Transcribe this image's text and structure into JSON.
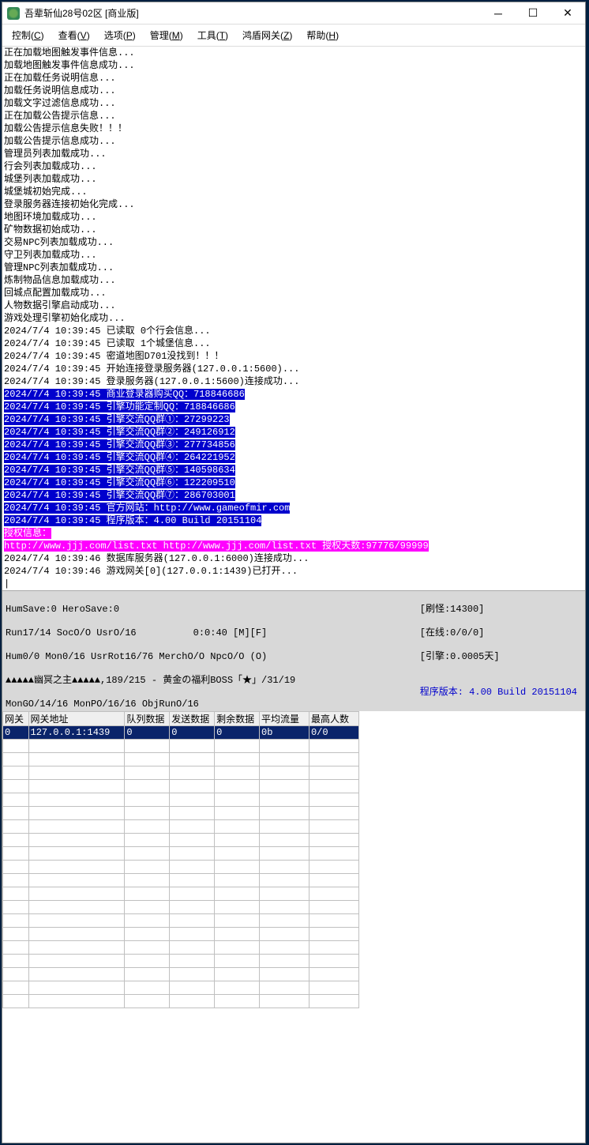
{
  "window": {
    "title": "吾辈斩仙28号02区 [商业版]"
  },
  "menu": {
    "items": [
      {
        "label": "控制",
        "key": "C"
      },
      {
        "label": "查看",
        "key": "V"
      },
      {
        "label": "选项",
        "key": "P"
      },
      {
        "label": "管理",
        "key": "M"
      },
      {
        "label": "工具",
        "key": "T"
      },
      {
        "label": "鸿盾网关",
        "key": "Z"
      },
      {
        "label": "帮助",
        "key": "H"
      }
    ]
  },
  "log": [
    {
      "t": "正在加载地图触发事件信息..."
    },
    {
      "t": "加载地图触发事件信息成功..."
    },
    {
      "t": "正在加载任务说明信息..."
    },
    {
      "t": "加载任务说明信息成功..."
    },
    {
      "t": "加载文字过滤信息成功..."
    },
    {
      "t": "正在加载公告提示信息..."
    },
    {
      "t": "加载公告提示信息失败！！！"
    },
    {
      "t": "加载公告提示信息成功..."
    },
    {
      "t": "管理员列表加载成功..."
    },
    {
      "t": "行会列表加载成功..."
    },
    {
      "t": "城堡列表加载成功..."
    },
    {
      "t": "城堡城初始完成..."
    },
    {
      "t": "登录服务器连接初始化完成..."
    },
    {
      "t": "地图环境加载成功..."
    },
    {
      "t": "矿物数据初始成功..."
    },
    {
      "t": "交易NPC列表加载成功..."
    },
    {
      "t": "守卫列表加载成功..."
    },
    {
      "t": "管理NPC列表加载成功..."
    },
    {
      "t": "炼制物品信息加载成功..."
    },
    {
      "t": "回城点配置加载成功..."
    },
    {
      "t": "人物数据引擎启动成功..."
    },
    {
      "t": "游戏处理引擎初始化成功..."
    },
    {
      "t": "2024/7/4 10:39:45 已读取 0个行会信息..."
    },
    {
      "t": "2024/7/4 10:39:45 已读取 1个城堡信息..."
    },
    {
      "t": "2024/7/4 10:39:45 密道地图D701没找到！！！"
    },
    {
      "t": "2024/7/4 10:39:45 开始连接登录服务器(127.0.0.1:5600)..."
    },
    {
      "t": "2024/7/4 10:39:45 登录服务器(127.0.0.1:5600)连接成功..."
    },
    {
      "t": "2024/7/4 10:39:45 商业登录器购买QQ：718846686",
      "hl": "blue"
    },
    {
      "t": "2024/7/4 10:39:45 引擎功能定制QQ：718846686",
      "hl": "blue"
    },
    {
      "t": "2024/7/4 10:39:45 引擎交流QQ群①：27299223",
      "hl": "blue"
    },
    {
      "t": "2024/7/4 10:39:45 引擎交流QQ群②：249126912",
      "hl": "blue"
    },
    {
      "t": "2024/7/4 10:39:45 引擎交流QQ群③：277734856",
      "hl": "blue"
    },
    {
      "t": "2024/7/4 10:39:45 引擎交流QQ群④：264221952",
      "hl": "blue"
    },
    {
      "t": "2024/7/4 10:39:45 引擎交流QQ群⑤：140598634",
      "hl": "blue"
    },
    {
      "t": "2024/7/4 10:39:45 引擎交流QQ群⑥：122209510",
      "hl": "blue"
    },
    {
      "t": "2024/7/4 10:39:45 引擎交流QQ群⑦：286703001",
      "hl": "blue"
    },
    {
      "t": "2024/7/4 10:39:45 官方网站：http://www.gameofmir.com",
      "hl": "blue"
    },
    {
      "t": "2024/7/4 10:39:45 程序版本：4.00 Build 20151104",
      "hl": "blue"
    },
    {
      "t": "授权信息：",
      "hl": "mag"
    },
    {
      "t": "http://www.jjj.com/list.txt http://www.jjj.com/list.txt 授权天数:97776/99999",
      "hl": "mag"
    },
    {
      "t": "2024/7/4 10:39:46 数据库服务器(127.0.0.1:6000)连接成功..."
    },
    {
      "t": "2024/7/4 10:39:46 游戏网关[0](127.0.0.1:1439)已打开..."
    }
  ],
  "status": {
    "line1": "HumSave:0 HeroSave:0",
    "line2": "Run17/14 SocO/O UsrO/16          0:0:40 [M][F]",
    "line3": "Hum0/0 Mon0/16 UsrRot16/76 MerchO/O NpcO/O (O)",
    "line4": "▲▲▲▲▲幽冥之主▲▲▲▲▲,189/215 - 黄金の福利BOSS「★」/31/19",
    "line5": "MonGO/14/16 MonPO/16/16 ObjRunO/16",
    "r1": "[刷怪:14300]",
    "r2": "[在线:0/0/0]",
    "r3": "[引擎:0.0005天]",
    "version": "程序版本: 4.00 Build 20151104"
  },
  "table": {
    "headers": [
      "网关",
      "网关地址",
      "队列数据",
      "发送数据",
      "剩余数据",
      "平均流量",
      "最高人数"
    ],
    "rows": [
      {
        "gw": "0",
        "addr": "127.0.0.1:1439",
        "q": "0",
        "s": "0",
        "r": "0",
        "avg": "0b",
        "max": "0/0",
        "sel": true
      }
    ],
    "empty_rows": 20
  }
}
